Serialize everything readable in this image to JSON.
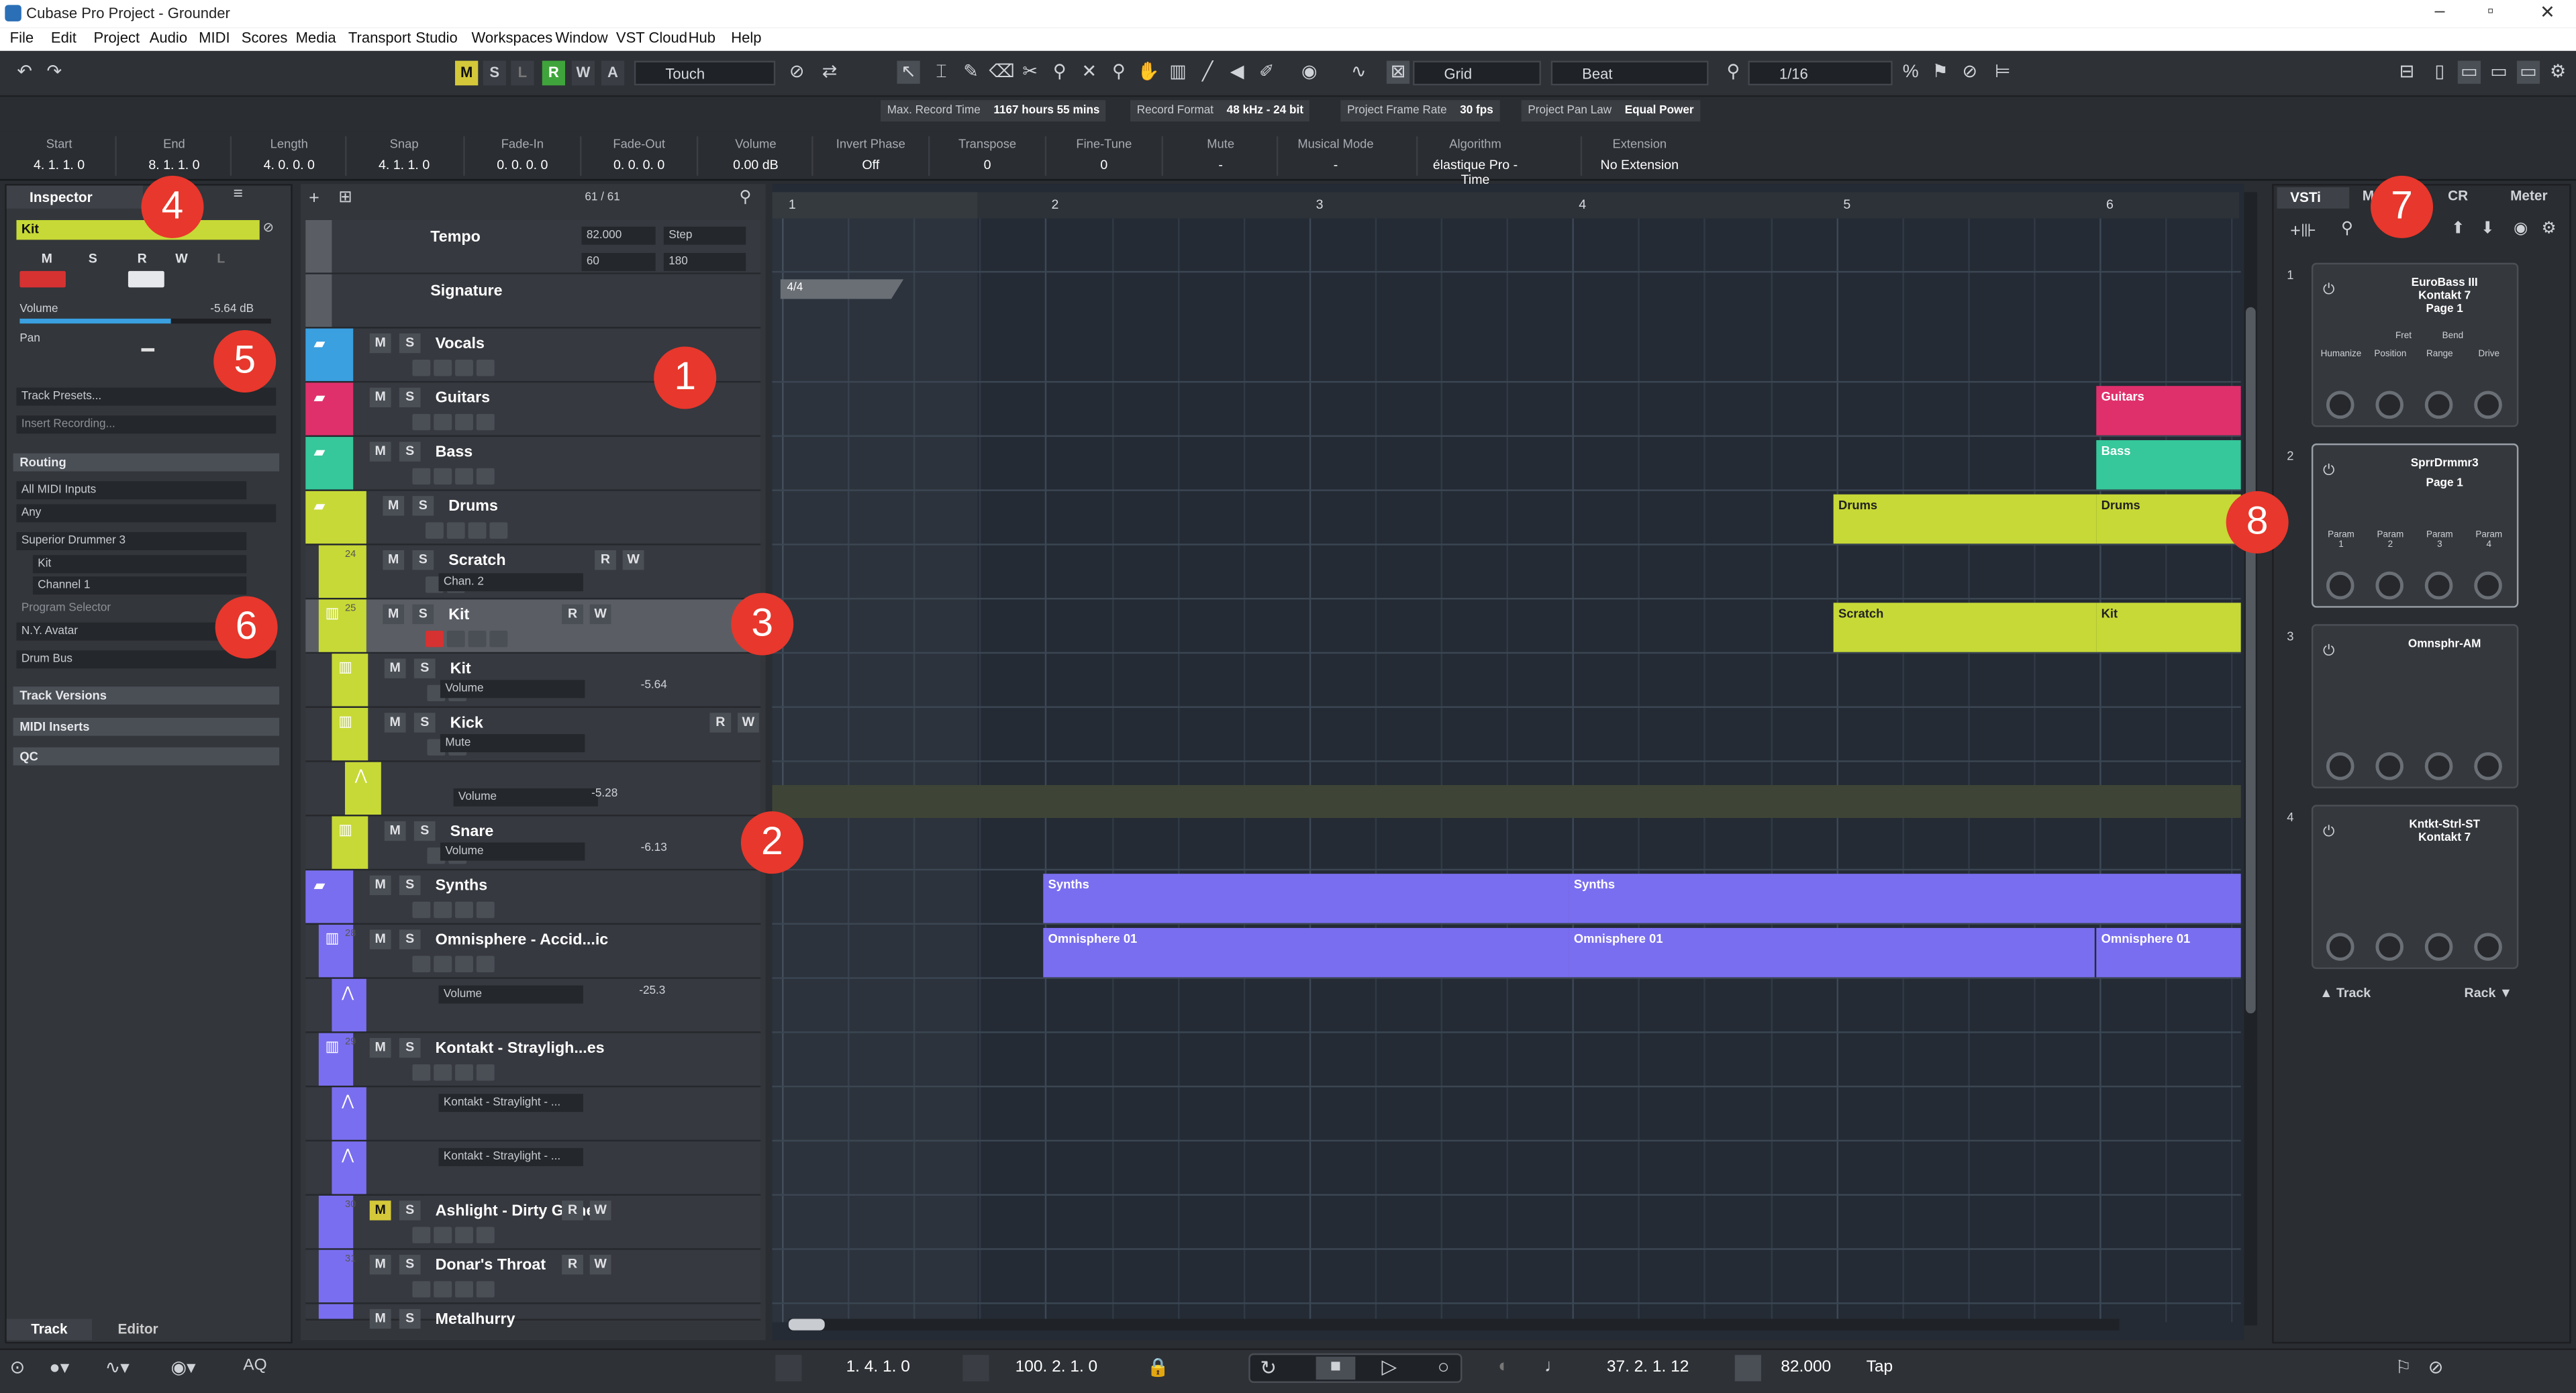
{
  "window": {
    "title": "Cubase Pro Project - Grounder"
  },
  "menu": [
    "File",
    "Edit",
    "Project",
    "Audio",
    "MIDI",
    "Scores",
    "Media",
    "Transport",
    "Studio",
    "Workspaces",
    "Window",
    "VST Cloud",
    "Hub",
    "Help"
  ],
  "toolbar": {
    "state_buttons": [
      "M",
      "S",
      "L",
      "R",
      "W",
      "A"
    ],
    "automation_mode": "Touch",
    "snap_type": "Grid",
    "grid_type": "Beat",
    "quantize": "1/16"
  },
  "status": [
    {
      "label": "Max. Record Time",
      "value": "1167 hours 55 mins"
    },
    {
      "label": "Record Format",
      "value": "48 kHz - 24 bit"
    },
    {
      "label": "Project Frame Rate",
      "value": "30 fps"
    },
    {
      "label": "Project Pan Law",
      "value": "Equal Power"
    }
  ],
  "infoline": [
    {
      "label": "Start",
      "value": "4. 1. 1.   0"
    },
    {
      "label": "End",
      "value": "8. 1. 1.   0"
    },
    {
      "label": "Length",
      "value": "4. 0. 0.   0"
    },
    {
      "label": "Snap",
      "value": "4. 1. 1.   0"
    },
    {
      "label": "Fade-In",
      "value": "0. 0. 0.   0"
    },
    {
      "label": "Fade-Out",
      "value": "0. 0. 0.   0"
    },
    {
      "label": "Volume",
      "value": "0.00      dB"
    },
    {
      "label": "Invert Phase",
      "value": "Off"
    },
    {
      "label": "Transpose",
      "value": "0"
    },
    {
      "label": "Fine-Tune",
      "value": "0"
    },
    {
      "label": "Mute",
      "value": "-"
    },
    {
      "label": "Musical Mode",
      "value": "-"
    },
    {
      "label": "Algorithm",
      "value": "élastique Pro - Time"
    },
    {
      "label": "Extension",
      "value": "No Extension"
    }
  ],
  "inspector": {
    "tab": "Inspector",
    "track_name": "Kit",
    "volume_label": "Volume",
    "volume_value": "-5.64 dB",
    "pan_label": "Pan",
    "track_presets": "Track Presets...",
    "insert_recording": "Insert Recording...",
    "routing": "Routing",
    "input": "All MIDI Inputs",
    "channel_in": "Any",
    "output": "Superior Drummer 3",
    "kit": "Kit",
    "channel": "Channel 1",
    "program_selector": "Program Selector",
    "program": "N.Y. Avatar",
    "bus": "Drum Bus",
    "sections": [
      "Track Versions",
      "MIDI Inserts",
      "QC"
    ],
    "bottom_tabs": [
      "Track",
      "Editor"
    ]
  },
  "tracklist": {
    "count": "61 / 61",
    "tempo": {
      "name": "Tempo",
      "bpm": "82.000",
      "mode": "Step",
      "v1": "60",
      "v2": "180"
    },
    "signature": "Signature",
    "time_sig": "4/4"
  },
  "tracks": {
    "vocals": "Vocals",
    "guitars": "Guitars",
    "bass": "Bass",
    "drums": "Drums",
    "scratch": "Scratch",
    "scratch_num": "24",
    "scratch_chan": "Chan. 2",
    "kit": "Kit",
    "kit_num": "25",
    "kit_sub": "Kit",
    "kit_param": "Volume",
    "kit_val": "-5.64",
    "kick": "Kick",
    "kick_param": "Mute",
    "auto_param": "Volume",
    "auto_val": "-5.28",
    "snare": "Snare",
    "snare_param": "Volume",
    "snare_val": "-6.13",
    "synths": "Synths",
    "omni": "Omnisphere - Accid...ic",
    "omni_num": "28",
    "omni_param": "Volume",
    "omni_val": "-25.3",
    "kontakt": "Kontakt - Strayligh...es",
    "kontakt_num": "29",
    "kontakt_p1": "Kontakt - Straylight - ...",
    "kontakt_p2": "Kontakt - Straylight - ...",
    "ashlight": "Ashlight - Dirty Game",
    "ashlight_num": "30",
    "donar": "Donar's Throat",
    "donar_num": "31",
    "metal": "Metalhurry"
  },
  "ruler": [
    "1",
    "2",
    "3",
    "4",
    "5",
    "6"
  ],
  "events": {
    "guitars": "Guitars",
    "bass": "Bass",
    "drums1": "Drums",
    "drums2": "Drums",
    "scratch": "Scratch",
    "kit": "Kit",
    "synths1": "Synths",
    "synths2": "Synths",
    "omni1": "Omnisphere 01",
    "omni2": "Omnisphere 01",
    "omni3": "Omnisphere 01"
  },
  "rightzone": {
    "tabs": [
      "VSTi",
      "M",
      "CR",
      "Meter"
    ],
    "footer_track": "Track",
    "footer_rack": "Rack",
    "slots": [
      {
        "num": "1",
        "name": "EuroBass III",
        "sub": "Kontakt 7",
        "page": "Page 1",
        "params": [
          "Humanize",
          "Position",
          "Range",
          "Drive"
        ],
        "params_top": [
          "Fret",
          "Bend"
        ]
      },
      {
        "num": "2",
        "name": "SprrDrmmr3",
        "page": "Page 1",
        "params": [
          "Param\n1",
          "Param\n2",
          "Param\n3",
          "Param\n4"
        ]
      },
      {
        "num": "3",
        "name": "Omnsphr-AM"
      },
      {
        "num": "4",
        "name": "Kntkt-Strl-ST",
        "sub": "Kontakt 7"
      }
    ]
  },
  "transport": {
    "left_locator": "1. 4. 1.   0",
    "right_locator": "100. 2. 1.   0",
    "position": "37. 2. 1. 12",
    "tempo": "82.000",
    "tap": "Tap",
    "aq": "AQ"
  },
  "badges": [
    "1",
    "2",
    "3",
    "4",
    "5",
    "6",
    "7",
    "8"
  ],
  "colors": {
    "vocals": "#3aa0e0",
    "guitars": "#e0306c",
    "bass": "#36c79a",
    "drums": "#c7d936",
    "synths": "#7a6ef0",
    "accent_yellow": "#d4c83a",
    "record_red": "#d63232",
    "badge": "#e8372c"
  }
}
